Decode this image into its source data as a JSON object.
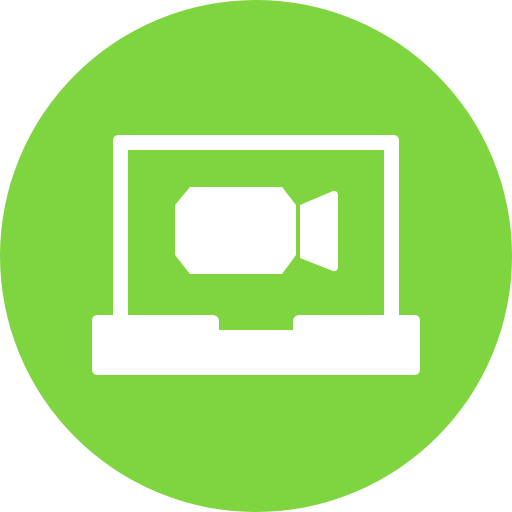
{
  "icon": {
    "name": "laptop-video-call-icon",
    "colors": {
      "background": "#ffffff",
      "circle": "#7ed540",
      "glyph": "#ffffff"
    }
  }
}
